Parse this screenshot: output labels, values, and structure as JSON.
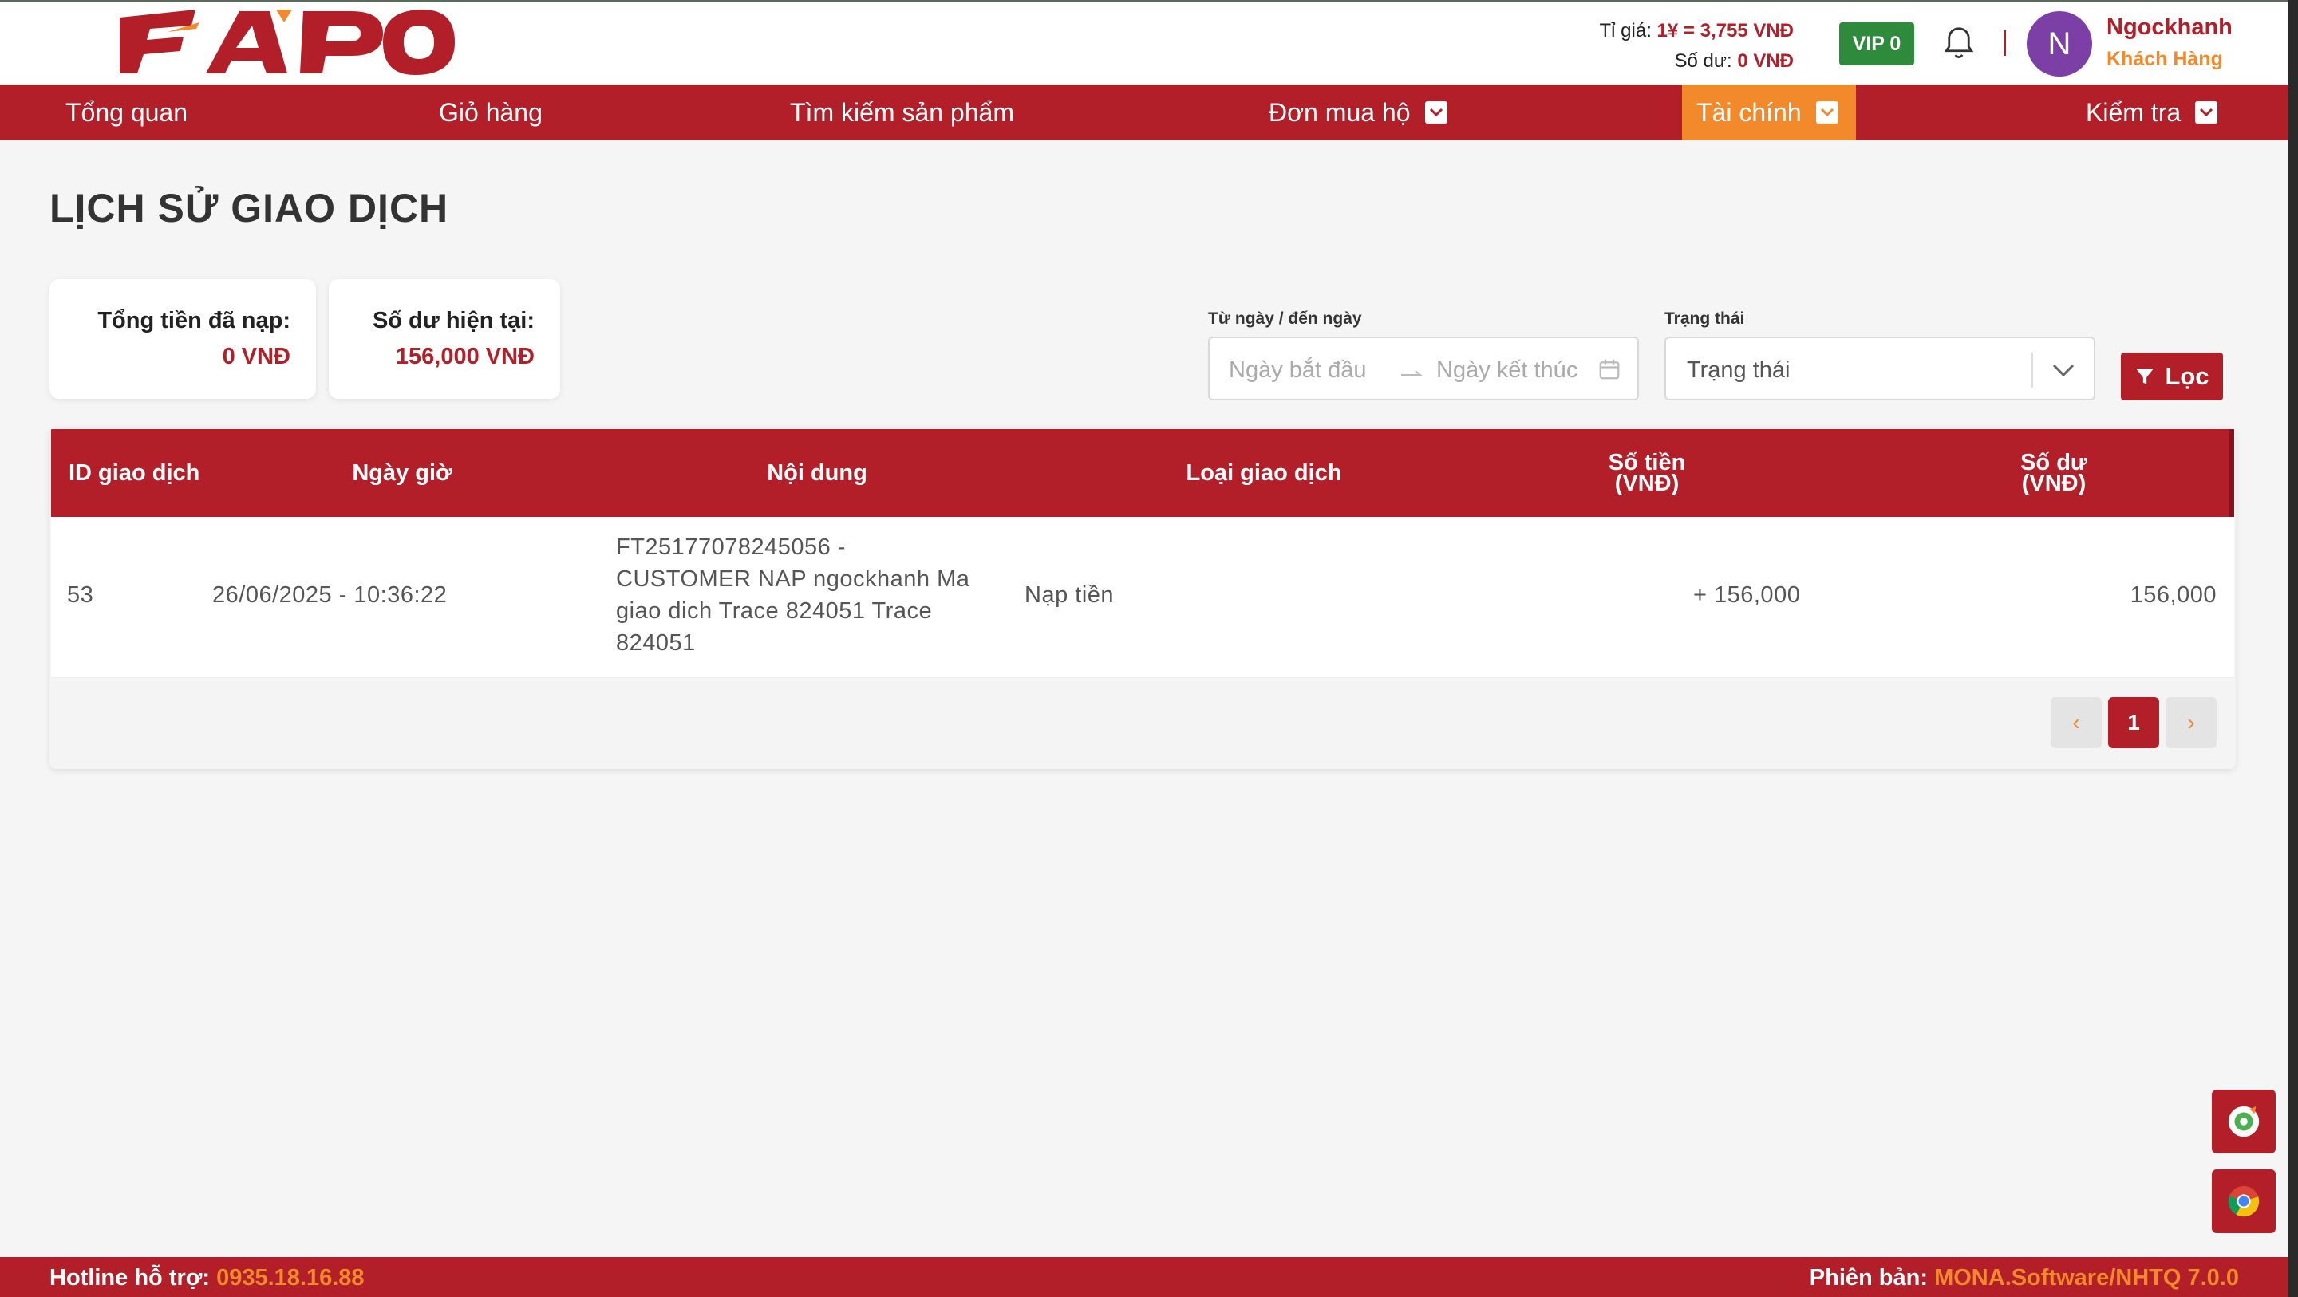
{
  "header": {
    "logo_text": "FAPO",
    "exchange_rate_label": "Tỉ giá:",
    "exchange_rate_value": "1¥ = 3,755 VNĐ",
    "balance_label": "Số dư:",
    "balance_value": "0 VNĐ",
    "vip_badge": "VIP 0",
    "avatar_initial": "N",
    "user_name": "Ngockhanh",
    "user_role": "Khách Hàng"
  },
  "nav": {
    "items": [
      {
        "label": "Tổng quan"
      },
      {
        "label": "Giỏ hàng"
      },
      {
        "label": "Tìm kiếm sản phẩm"
      },
      {
        "label": "Đơn mua hộ"
      },
      {
        "label": "Tài chính"
      },
      {
        "label": "Kiểm tra"
      }
    ]
  },
  "page": {
    "title": "LỊCH SỬ GIAO DỊCH"
  },
  "stats": {
    "total_deposit_label": "Tổng tiền đã nạp:",
    "total_deposit_value": "0 VNĐ",
    "current_balance_label": "Số dư hiện tại:",
    "current_balance_value": "156,000 VNĐ"
  },
  "filters": {
    "date_label": "Từ ngày / đến ngày",
    "start_placeholder": "Ngày bắt đầu",
    "end_placeholder": "Ngày kết thúc",
    "status_label": "Trạng thái",
    "status_placeholder": "Trạng thái",
    "filter_button": "Lọc"
  },
  "table": {
    "columns": {
      "id": "ID giao dịch",
      "datetime": "Ngày giờ",
      "content": "Nội dung",
      "type": "Loại giao dịch",
      "amount_l1": "Số tiền",
      "amount_l2": "(VNĐ)",
      "balance_l1": "Số dư",
      "balance_l2": "(VNĐ)"
    },
    "rows": [
      {
        "id": "53",
        "datetime": "26/06/2025 - 10:36:22",
        "content_lines": [
          "FT25177078245056 -",
          "CUSTOMER NAP ngockhanh Ma",
          "giao dich Trace 824051 Trace",
          "824051"
        ],
        "type": "Nạp tiền",
        "amount": "+ 156,000",
        "balance": "156,000"
      }
    ]
  },
  "pagination": {
    "prev": "‹",
    "current": "1",
    "next": "›"
  },
  "footer": {
    "hotline_label": "Hotline hỗ trợ:",
    "hotline_value": "0935.18.16.88",
    "version_label": "Phiên bản:",
    "version_value": "MONA.Software/NHTQ 7.0.0"
  },
  "colors": {
    "brand_red": "#b31f29",
    "accent_orange": "#f28a2c",
    "vip_green": "#2e8b3c",
    "avatar_purple": "#7b3fa6"
  }
}
